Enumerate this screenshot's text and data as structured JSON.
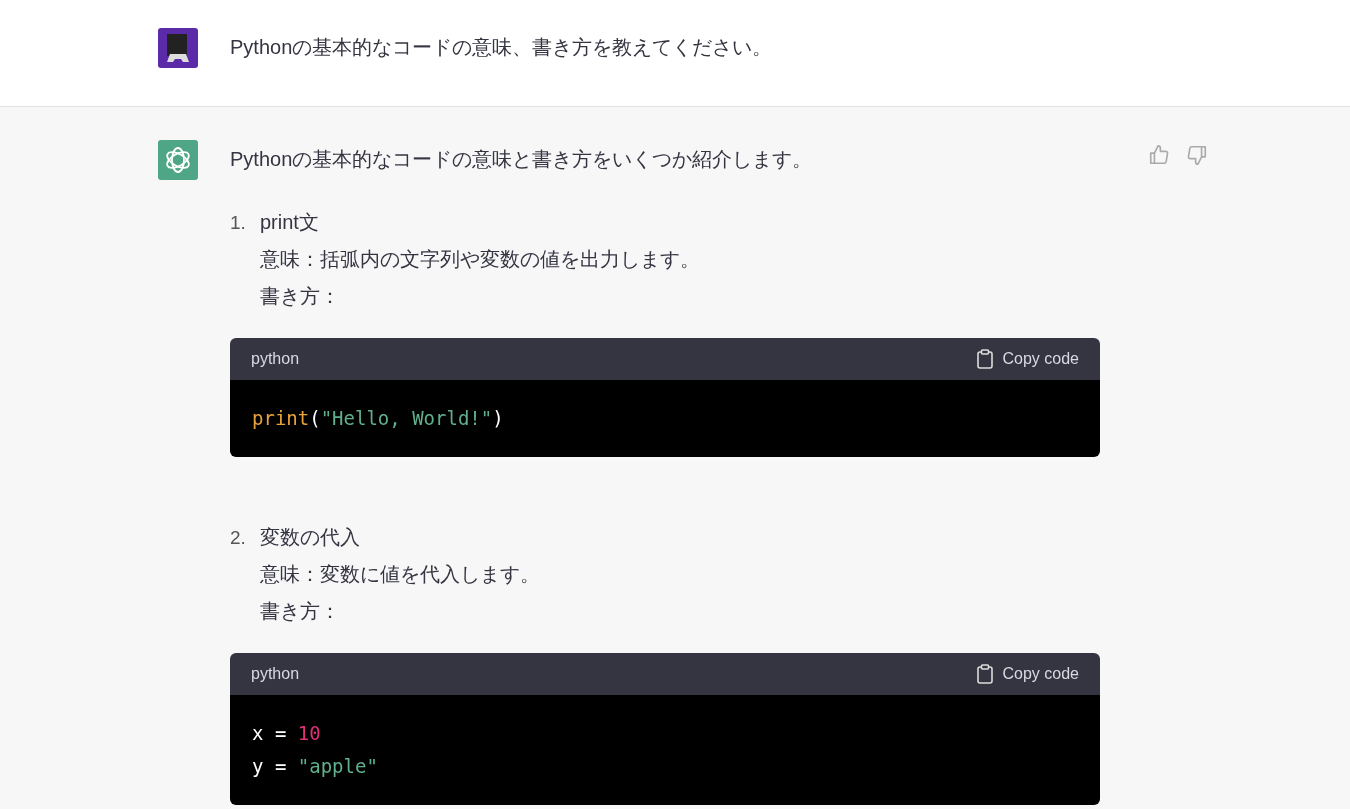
{
  "user_message": {
    "text": "Pythonの基本的なコードの意味、書き方を教えてください。"
  },
  "assistant_message": {
    "intro": "Pythonの基本的なコードの意味と書き方をいくつか紹介します。",
    "items": [
      {
        "number": "1.",
        "title": "print文",
        "lines": [
          "意味：括弧内の文字列や変数の値を出力します。",
          "書き方："
        ],
        "code": {
          "language": "python",
          "copy_label": "Copy code",
          "lines": [
            [
              {
                "kind": "function",
                "text": "print"
              },
              {
                "kind": "plain",
                "text": "("
              },
              {
                "kind": "string",
                "text": "\"Hello, World!\""
              },
              {
                "kind": "plain",
                "text": ")"
              }
            ]
          ]
        }
      },
      {
        "number": "2.",
        "title": "変数の代入",
        "lines": [
          "意味：変数に値を代入します。",
          "書き方："
        ],
        "code": {
          "language": "python",
          "copy_label": "Copy code",
          "lines": [
            [
              {
                "kind": "plain",
                "text": "x = "
              },
              {
                "kind": "number",
                "text": "10"
              }
            ],
            [
              {
                "kind": "plain",
                "text": "y = "
              },
              {
                "kind": "string",
                "text": "\"apple\""
              }
            ]
          ]
        }
      }
    ]
  }
}
